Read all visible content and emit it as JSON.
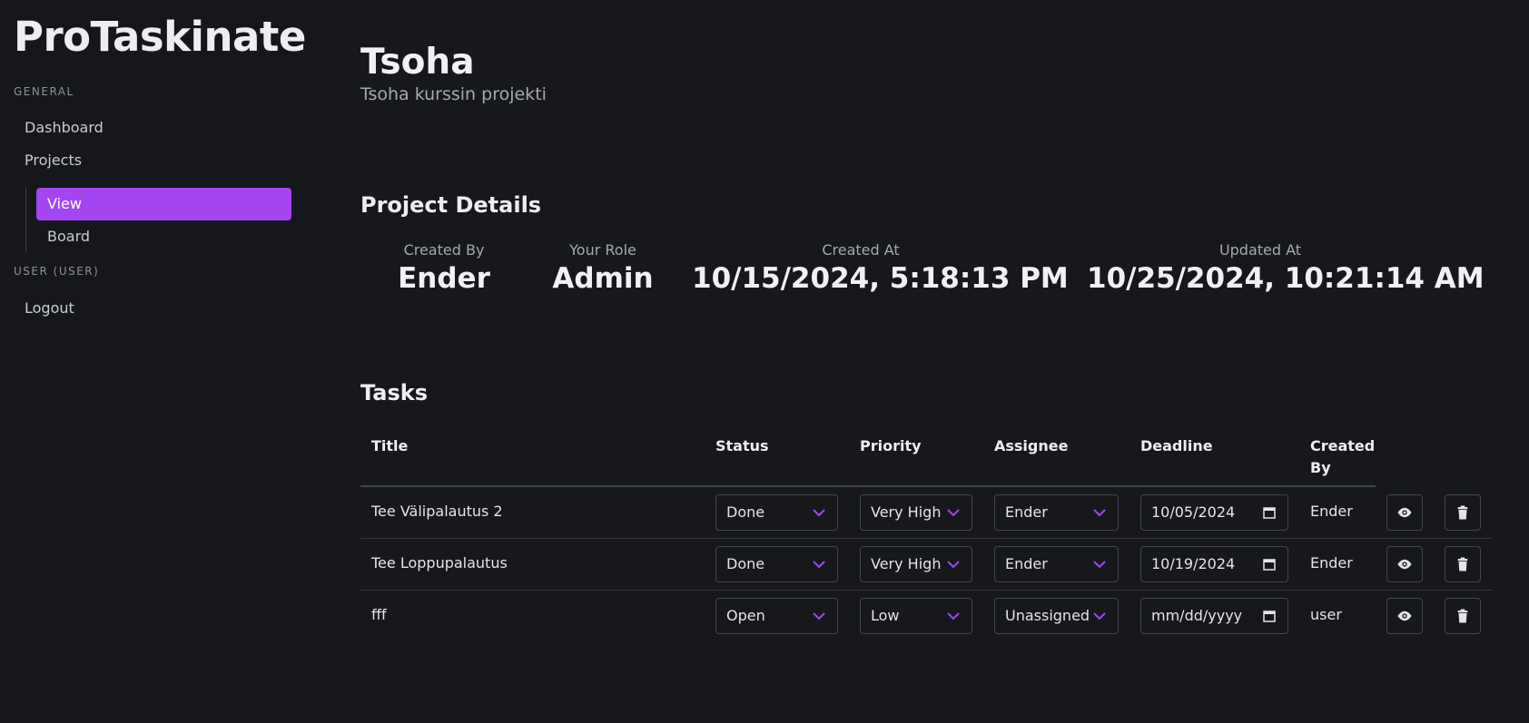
{
  "app": {
    "brand": "ProTaskinate"
  },
  "sidebar": {
    "general_label": "GENERAL",
    "dashboard": "Dashboard",
    "projects": "Projects",
    "sub_items": [
      "View",
      "Board"
    ],
    "user_label": "USER (USER)",
    "logout": "Logout"
  },
  "project": {
    "title": "Tsoha",
    "description": "Tsoha kurssin projekti"
  },
  "details": {
    "heading": "Project Details",
    "created_by_label": "Created By",
    "created_by": "Ender",
    "role_label": "Your Role",
    "role": "Admin",
    "created_at_label": "Created At",
    "created_at": "10/15/2024, 5:18:13 PM",
    "updated_at_label": "Updated At",
    "updated_at": "10/25/2024, 10:21:14 AM"
  },
  "tasks": {
    "heading": "Tasks",
    "columns": {
      "title": "Title",
      "status": "Status",
      "priority": "Priority",
      "assignee": "Assignee",
      "deadline": "Deadline",
      "created_by_1": "Created",
      "created_by_2": "By"
    },
    "rows": [
      {
        "title": "Tee Välipalautus 2",
        "status": "Done",
        "priority": "Very High",
        "assignee": "Ender",
        "deadline": "10/05/2024",
        "created_by": "Ender"
      },
      {
        "title": "Tee Loppupalautus",
        "status": "Done",
        "priority": "Very High",
        "assignee": "Ender",
        "deadline": "10/19/2024",
        "created_by": "Ender"
      },
      {
        "title": "fff",
        "status": "Open",
        "priority": "Low",
        "assignee": "Unassigned",
        "deadline": "mm/dd/yyyy",
        "created_by": "user"
      }
    ]
  },
  "colors": {
    "accent": "#a346f2",
    "background": "#17181c"
  },
  "icons": {
    "view": "eye-icon",
    "delete": "trash-icon",
    "dropdown": "chevron-down-icon",
    "calendar": "calendar-icon"
  }
}
